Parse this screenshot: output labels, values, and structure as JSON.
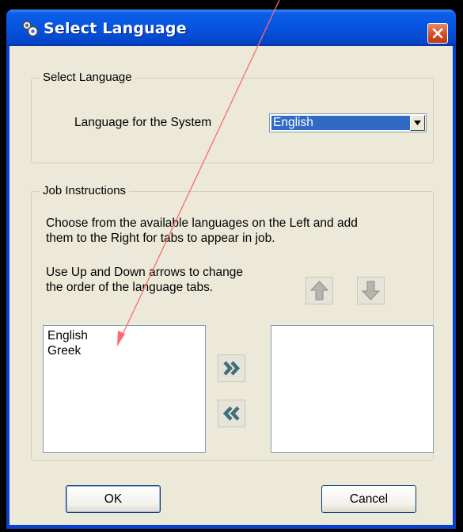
{
  "window": {
    "title": "Select Language",
    "icon": "gears-icon",
    "close_icon": "close-icon"
  },
  "system_group": {
    "legend": "Select Language",
    "field_label": "Language for the System",
    "selected_value": "English"
  },
  "job_group": {
    "legend": "Job Instructions",
    "instructions_line1": "Choose from the available languages on the Left and add",
    "instructions_line2": "them to the Right for tabs to appear in job.",
    "order_line1": "Use Up and Down arrows to change",
    "order_line2": "the order of the language tabs.",
    "available_languages": [
      "English",
      "Greek"
    ],
    "selected_languages": []
  },
  "buttons": {
    "ok": "OK",
    "cancel": "Cancel"
  },
  "colors": {
    "titlebar": "#0654de",
    "face": "#ece9d8",
    "selection": "#316ac5",
    "annotation": "#ff6b6b"
  }
}
